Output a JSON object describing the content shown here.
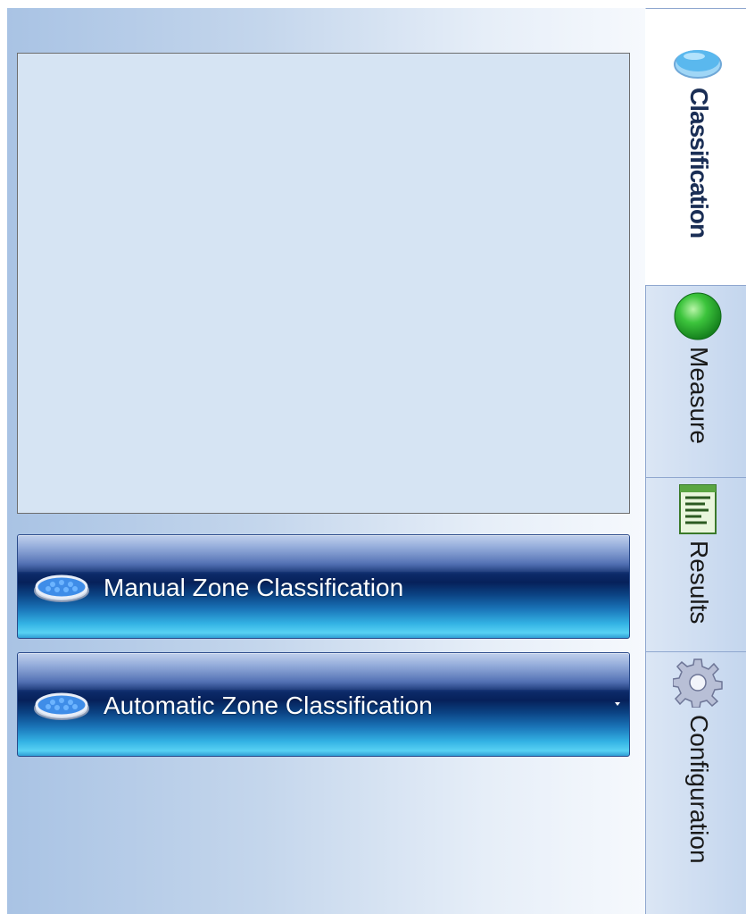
{
  "preview": {},
  "buttons": {
    "manual": {
      "label": "Manual Zone Classification",
      "icon": "petri-dish-icon"
    },
    "automatic": {
      "label": "Automatic Zone Classification",
      "icon": "petri-dish-icon",
      "has_dropdown": true
    }
  },
  "tabs": [
    {
      "label": "Classification",
      "icon": "lens-icon",
      "active": true
    },
    {
      "label": "Measure",
      "icon": "green-circle-icon",
      "active": false
    },
    {
      "label": "Results",
      "icon": "report-icon",
      "active": false
    },
    {
      "label": "Configuration",
      "icon": "gear-icon",
      "active": false
    }
  ],
  "colors": {
    "button_dark": "#06215a",
    "button_light": "#58d1f3",
    "panel_left": "#a9c3e4",
    "measure_green": "#3cc43c",
    "lens_blue": "#5ab8ee"
  }
}
